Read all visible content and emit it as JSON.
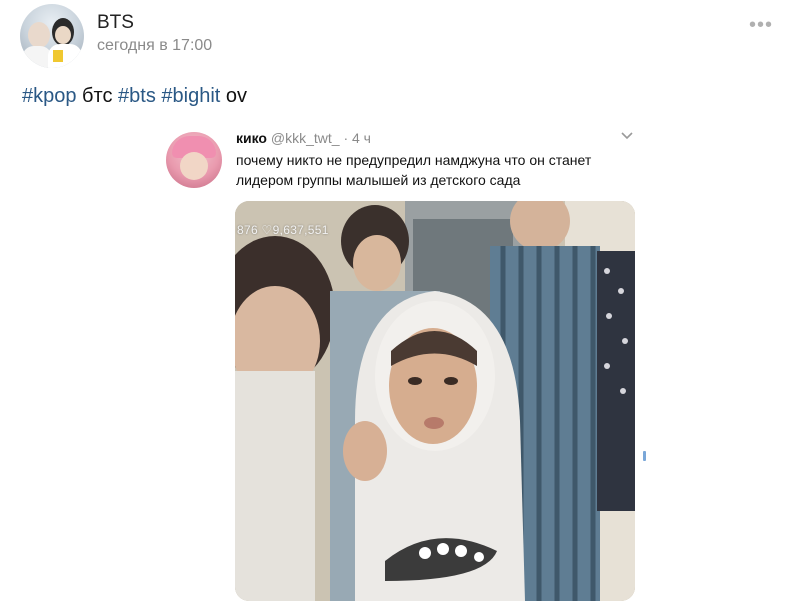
{
  "post": {
    "author": "BTS",
    "time": "сегодня в 17:00",
    "text": {
      "tag1": "#kpop",
      "word": " бтс ",
      "tag2": "#bts",
      "space": " ",
      "tag3": "#bighit",
      "tail": " ov"
    }
  },
  "quoted_tweet": {
    "name": "кико",
    "meta": " @kkk_twt_ · 4 ч",
    "text": "почему никто не предупредил намджуна что он станет лидером группы малышей из детского сада",
    "media_stats": "876 ♡9,637,551"
  },
  "icons": {
    "more": "more-dots-icon",
    "chevron": "chevron-down-icon",
    "heart": "heart-icon"
  },
  "colors": {
    "hashtag": "#2a5885",
    "meta": "#8a8a8a"
  }
}
